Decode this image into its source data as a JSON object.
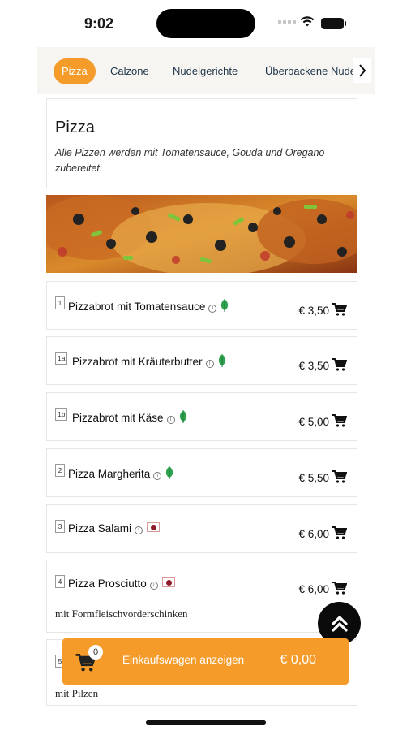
{
  "status": {
    "time": "9:02"
  },
  "tabs": [
    {
      "label": "Pizza",
      "active": true
    },
    {
      "label": "Calzone"
    },
    {
      "label": "Nudelgerichte"
    },
    {
      "label": "Überbackene Nude"
    }
  ],
  "section": {
    "title": "Pizza",
    "description": "Alle Pizzen werden mit Tomatensauce, Gouda und Oregano zubereitet."
  },
  "items": [
    {
      "num": "1",
      "name": "Pizzabrot mit Tomatensauce",
      "price": "€ 3,50",
      "badge": "leaf-icon"
    },
    {
      "num": "1a",
      "name": "Pizzabrot mit Kräuterbutter",
      "price": "€ 3,50",
      "badge": "leaf-icon"
    },
    {
      "num": "1b",
      "name": "Pizzabrot mit Käse",
      "price": "€ 5,00",
      "badge": "leaf-icon"
    },
    {
      "num": "2",
      "name": "Pizza Margherita",
      "price": "€ 5,50",
      "badge": "leaf-icon"
    },
    {
      "num": "3",
      "name": "Pizza Salami",
      "price": "€ 6,00",
      "badge": "meat-icon"
    },
    {
      "num": "4",
      "name": "Pizza Prosciutto",
      "price": "€ 6,00",
      "badge": "meat-icon",
      "desc": "mit Formfleischvorderschinken"
    },
    {
      "num": "5",
      "desc": "mit Pilzen"
    }
  ],
  "cart": {
    "count": "0",
    "label": "Einkaufswagen anzeigen",
    "total": "€ 0,00"
  },
  "colors": {
    "accent": "#f59b2a",
    "text": "#1d3447",
    "leaf": "#2fa24f",
    "meat": "#8e1b2a"
  }
}
